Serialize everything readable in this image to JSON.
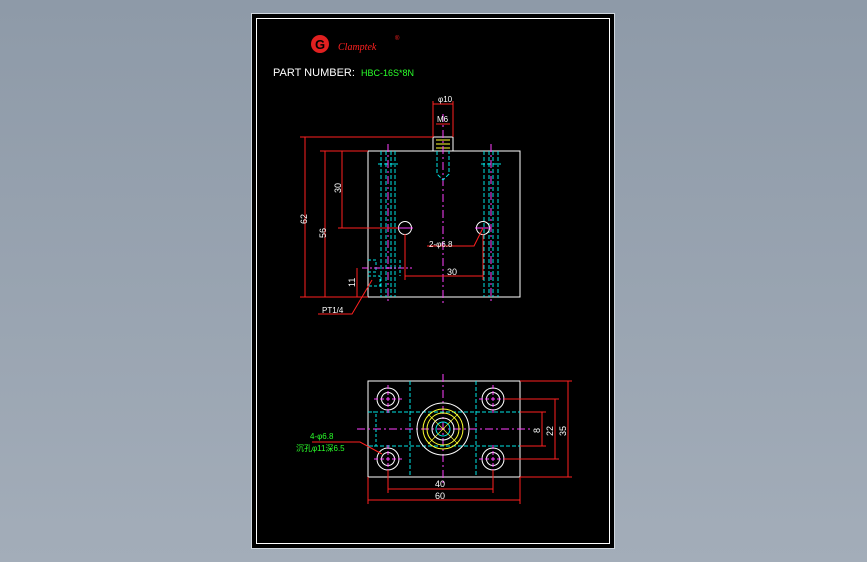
{
  "brand": {
    "name": "Clamptek",
    "mark": "®",
    "logo_letter": "G",
    "color": "#e02020"
  },
  "title_block": {
    "label": "PART NUMBER:",
    "value": "HBC-16S*8N"
  },
  "dimensions": {
    "top_dia": "φ10",
    "thread": "M6",
    "height_total": "62",
    "height_inner": "56",
    "height_upper": "30",
    "height_lower": "11",
    "hole_spacing": "30",
    "holes_front": "2-φ6.8",
    "port": "PT1/4",
    "holes_plan_line1": "4-φ6.8",
    "holes_plan_line2": "沉孔φ11深6.5",
    "width_inner": "40",
    "width_total": "60",
    "depth_a": "8",
    "depth_b": "22",
    "depth_c": "35"
  },
  "colors": {
    "outline": "#ffffff",
    "hidden": "#00e5e5",
    "center": "#ff40ff",
    "dimension": "#ff2020",
    "text": "#2aff2a",
    "flange": "#ffff30"
  }
}
